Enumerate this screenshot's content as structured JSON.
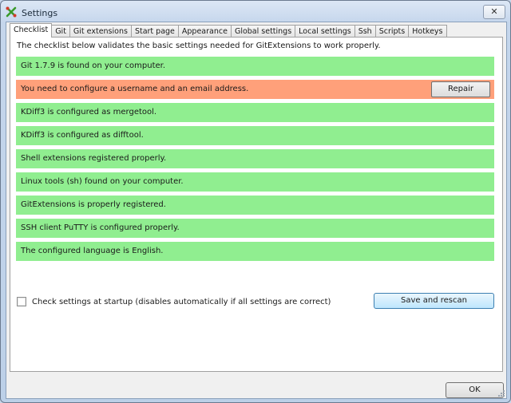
{
  "window": {
    "title": "Settings",
    "close_glyph": "✕"
  },
  "tabs": [
    {
      "label": "Checklist",
      "active": true
    },
    {
      "label": "Git"
    },
    {
      "label": "Git extensions"
    },
    {
      "label": "Start page"
    },
    {
      "label": "Appearance"
    },
    {
      "label": "Global settings"
    },
    {
      "label": "Local settings"
    },
    {
      "label": "Ssh"
    },
    {
      "label": "Scripts"
    },
    {
      "label": "Hotkeys"
    }
  ],
  "checklist": {
    "intro": "The checklist below validates the basic settings needed for GitExtensions to work properly.",
    "items": [
      {
        "text": "Git 1.7.9 is found on your computer.",
        "status": "ok"
      },
      {
        "text": "You need to configure a username and an email address.",
        "status": "error",
        "action": "Repair"
      },
      {
        "text": "KDiff3 is configured as mergetool.",
        "status": "ok"
      },
      {
        "text": "KDiff3 is configured as difftool.",
        "status": "ok"
      },
      {
        "text": "Shell extensions registered properly.",
        "status": "ok"
      },
      {
        "text": "Linux tools (sh) found on your computer.",
        "status": "ok"
      },
      {
        "text": "GitExtensions is properly registered.",
        "status": "ok"
      },
      {
        "text": "SSH client PuTTY is configured properly.",
        "status": "ok"
      },
      {
        "text": "The configured language is English.",
        "status": "ok"
      }
    ],
    "startup_check_label": "Check settings at startup (disables automatically if all settings are correct)",
    "startup_check_checked": false,
    "save_button": "Save and rescan"
  },
  "footer": {
    "ok_button": "OK"
  },
  "colors": {
    "ok": "#90ee90",
    "error": "#ffa07a"
  }
}
